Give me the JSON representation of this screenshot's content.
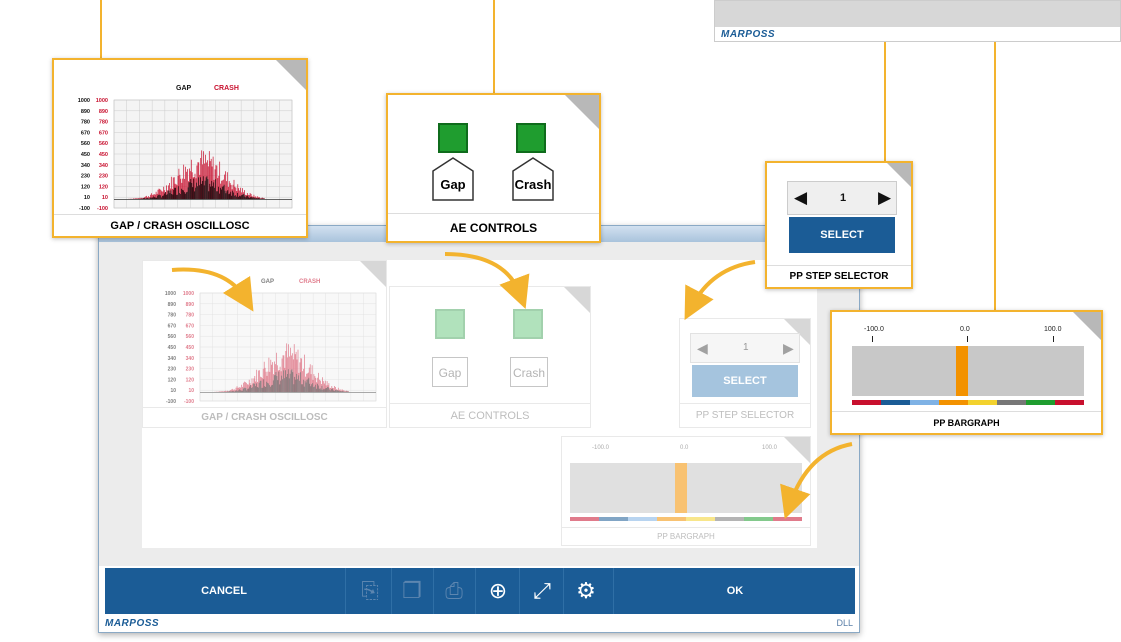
{
  "brand": "MARPOSS",
  "corner_mark": "DLL",
  "widgets": {
    "gap_crash": {
      "caption": "GAP / CRASH OSCILLOSC",
      "legend_gap": "GAP",
      "legend_crash": "CRASH",
      "y_ticks_gap": [
        "1000",
        "890",
        "780",
        "670",
        "560",
        "450",
        "340",
        "230",
        "120",
        "10",
        "-100"
      ],
      "y_ticks_crash": [
        "1000",
        "890",
        "780",
        "670",
        "560",
        "450",
        "340",
        "230",
        "120",
        "10",
        "-100"
      ],
      "gap_color": "#111111",
      "crash_color": "#c8102e"
    },
    "ae_controls": {
      "caption": "AE CONTROLS",
      "gap_label": "Gap",
      "crash_label": "Crash",
      "led_color": "#1f9d2f"
    },
    "pp_step": {
      "caption": "PP STEP SELECTOR",
      "value": "1",
      "select_label": "SELECT",
      "select_color": "#1b5c96"
    },
    "pp_bargraph": {
      "caption": "PP BARGRAPH",
      "scale": [
        "-100.0",
        "0.0",
        "100.0"
      ],
      "value": 0.0,
      "bar_color": "#f39200",
      "strip_colors": [
        "#c8102e",
        "#1b5c96",
        "#7fb2e5",
        "#f39200",
        "#f3d22e",
        "#777777",
        "#1f9d2f",
        "#c8102e"
      ]
    }
  },
  "toolbar": {
    "cancel_label": "CANCEL",
    "ok_label": "OK",
    "icons": [
      {
        "name": "page-settings-icon",
        "enabled": false
      },
      {
        "name": "page-copy-icon",
        "enabled": false
      },
      {
        "name": "page-delete-icon",
        "enabled": false
      },
      {
        "name": "page-add-icon",
        "enabled": true
      },
      {
        "name": "fullscreen-icon",
        "enabled": true
      },
      {
        "name": "settings-gears-icon",
        "enabled": true
      }
    ]
  },
  "colors": {
    "accent": "#f3b32e",
    "toolbar_bg": "#1b5c96"
  }
}
